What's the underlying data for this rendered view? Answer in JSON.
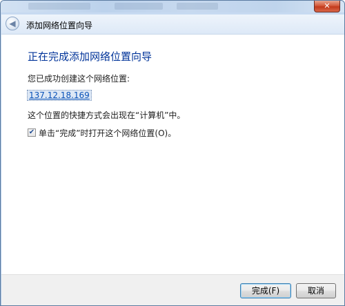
{
  "window": {
    "close_glyph": "✕",
    "title": "添加网络位置向导"
  },
  "content": {
    "heading": "正在完成添加网络位置向导",
    "success_message": "您已成功创建这个网络位置:",
    "network_address": "137.12.18.169",
    "shortcut_message": "这个位置的快捷方式会出现在“计算机”中。",
    "open_on_finish": {
      "label": "单击“完成”时打开这个网络位置(O)。",
      "checked": true
    }
  },
  "footer": {
    "finish_label": "完成(F)",
    "cancel_label": "取消"
  },
  "icons": {
    "back": "arrow-left-icon",
    "close": "close-icon",
    "check": "check-icon"
  },
  "colors": {
    "heading": "#003399",
    "link": "#0a52b8",
    "close_button": "#c23a1c"
  }
}
